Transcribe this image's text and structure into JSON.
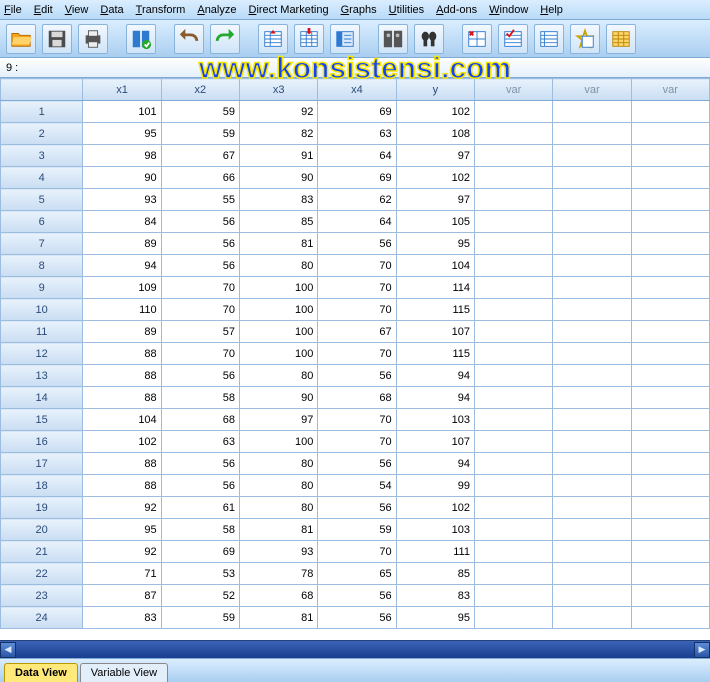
{
  "menu": [
    "File",
    "Edit",
    "View",
    "Data",
    "Transform",
    "Analyze",
    "Direct Marketing",
    "Graphs",
    "Utilities",
    "Add-ons",
    "Window",
    "Help"
  ],
  "name_box": "9 :",
  "watermark": "www.konsistensi.com",
  "columns": [
    "x1",
    "x2",
    "x3",
    "x4",
    "y",
    "var",
    "var",
    "var"
  ],
  "rows": [
    {
      "n": "1",
      "c": [
        "101",
        "59",
        "92",
        "69",
        "102",
        "",
        "",
        ""
      ]
    },
    {
      "n": "2",
      "c": [
        "95",
        "59",
        "82",
        "63",
        "108",
        "",
        "",
        ""
      ]
    },
    {
      "n": "3",
      "c": [
        "98",
        "67",
        "91",
        "64",
        "97",
        "",
        "",
        ""
      ]
    },
    {
      "n": "4",
      "c": [
        "90",
        "66",
        "90",
        "69",
        "102",
        "",
        "",
        ""
      ]
    },
    {
      "n": "5",
      "c": [
        "93",
        "55",
        "83",
        "62",
        "97",
        "",
        "",
        ""
      ]
    },
    {
      "n": "6",
      "c": [
        "84",
        "56",
        "85",
        "64",
        "105",
        "",
        "",
        ""
      ]
    },
    {
      "n": "7",
      "c": [
        "89",
        "56",
        "81",
        "56",
        "95",
        "",
        "",
        ""
      ]
    },
    {
      "n": "8",
      "c": [
        "94",
        "56",
        "80",
        "70",
        "104",
        "",
        "",
        ""
      ]
    },
    {
      "n": "9",
      "c": [
        "109",
        "70",
        "100",
        "70",
        "114",
        "",
        "",
        ""
      ]
    },
    {
      "n": "10",
      "c": [
        "110",
        "70",
        "100",
        "70",
        "115",
        "",
        "",
        ""
      ]
    },
    {
      "n": "11",
      "c": [
        "89",
        "57",
        "100",
        "67",
        "107",
        "",
        "",
        ""
      ]
    },
    {
      "n": "12",
      "c": [
        "88",
        "70",
        "100",
        "70",
        "115",
        "",
        "",
        ""
      ]
    },
    {
      "n": "13",
      "c": [
        "88",
        "56",
        "80",
        "56",
        "94",
        "",
        "",
        ""
      ]
    },
    {
      "n": "14",
      "c": [
        "88",
        "58",
        "90",
        "68",
        "94",
        "",
        "",
        ""
      ]
    },
    {
      "n": "15",
      "c": [
        "104",
        "68",
        "97",
        "70",
        "103",
        "",
        "",
        ""
      ]
    },
    {
      "n": "16",
      "c": [
        "102",
        "63",
        "100",
        "70",
        "107",
        "",
        "",
        ""
      ]
    },
    {
      "n": "17",
      "c": [
        "88",
        "56",
        "80",
        "56",
        "94",
        "",
        "",
        ""
      ]
    },
    {
      "n": "18",
      "c": [
        "88",
        "56",
        "80",
        "54",
        "99",
        "",
        "",
        ""
      ]
    },
    {
      "n": "19",
      "c": [
        "92",
        "61",
        "80",
        "56",
        "102",
        "",
        "",
        ""
      ]
    },
    {
      "n": "20",
      "c": [
        "95",
        "58",
        "81",
        "59",
        "103",
        "",
        "",
        ""
      ]
    },
    {
      "n": "21",
      "c": [
        "92",
        "69",
        "93",
        "70",
        "111",
        "",
        "",
        ""
      ]
    },
    {
      "n": "22",
      "c": [
        "71",
        "53",
        "78",
        "65",
        "85",
        "",
        "",
        ""
      ]
    },
    {
      "n": "23",
      "c": [
        "87",
        "52",
        "68",
        "56",
        "83",
        "",
        "",
        ""
      ]
    },
    {
      "n": "24",
      "c": [
        "83",
        "59",
        "81",
        "56",
        "95",
        "",
        "",
        ""
      ]
    }
  ],
  "tabs": {
    "data_view": "Data View",
    "variable_view": "Variable View"
  },
  "toolbar_icons": [
    "open",
    "save",
    "print",
    "recall",
    "undo",
    "redo",
    "goto-case",
    "goto-variable",
    "variables",
    "run",
    "find",
    "split",
    "weight",
    "select",
    "value-labels",
    "customize"
  ]
}
